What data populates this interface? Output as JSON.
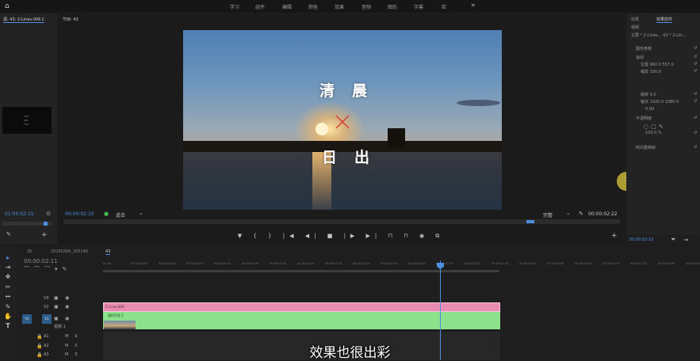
{
  "menu": {
    "workspaces": [
      "学习",
      "组件",
      "编辑",
      "颜色",
      "效果",
      "音频",
      "图形",
      "字幕",
      "库"
    ],
    "more": "»"
  },
  "source": {
    "tab": "源: 43: 2-Lines-006 C",
    "timecode": "01:00:02:15",
    "thumb_lines": [
      "TAB",
      "ABC",
      "TAB"
    ]
  },
  "program": {
    "tab": "节目: 43",
    "timecode": "00:00:02:10",
    "fit": "适合",
    "quality": "完整",
    "duration": "00:00:02:22",
    "title_top": "清晨",
    "title_bottom": "日出"
  },
  "effects": {
    "tab_a": "效果",
    "tab_b": "效果控件",
    "rows": [
      {
        "label": "视频"
      },
      {
        "label": "主要 * 2-Lines...  43 * 2-Lin..."
      },
      {
        "label": "图形参数"
      },
      {
        "label": "运动"
      },
      {
        "label": "位置 960.0  557.0"
      },
      {
        "label": "缩放 100.0"
      },
      {
        "label": "旋转 0.0"
      },
      {
        "label": "锚点 1920.0  1080.0"
      },
      {
        "label": "0.00"
      },
      {
        "label": "不透明度"
      },
      {
        "label": "100.0 %"
      },
      {
        "label": "时间重映射"
      }
    ],
    "timecode": "00:00:02:10"
  },
  "timeline": {
    "tab_a": "35",
    "tab_b": "20250306_105246",
    "tab_c": "43",
    "timecode": "00:00:02:11",
    "ticks": [
      "00:00",
      "00:00:00:05",
      "00:00:00:10",
      "00:00:00:15",
      "00:00:00:20",
      "00:00:01:00",
      "00:00:01:05",
      "00:00:01:10",
      "00:00:01:15",
      "00:00:01:20",
      "00:00:02:00",
      "00:00:02:05",
      "00:00:02:10",
      "00:00:02:15",
      "00:00:02:20",
      "00:00:03:00",
      "00:00:03:05",
      "00:00:03:10",
      "00:00:03:15",
      "00:00:03:20",
      "00:00:04:00",
      "00:00:04:05"
    ],
    "tracks": [
      {
        "id": "V3"
      },
      {
        "id": "V2"
      },
      {
        "id": "V1"
      },
      {
        "id": "A1"
      },
      {
        "id": "A2"
      },
      {
        "id": "A3"
      }
    ],
    "clip_pink": "2-Lines-006",
    "clip_green": "图形声音 2",
    "clip_v1": "视频 1"
  },
  "caption": "效果也很出彩",
  "colors": {
    "accent": "#4b8fe0",
    "pink_clip": "#e88cb2",
    "green_clip": "#8ce18c"
  }
}
